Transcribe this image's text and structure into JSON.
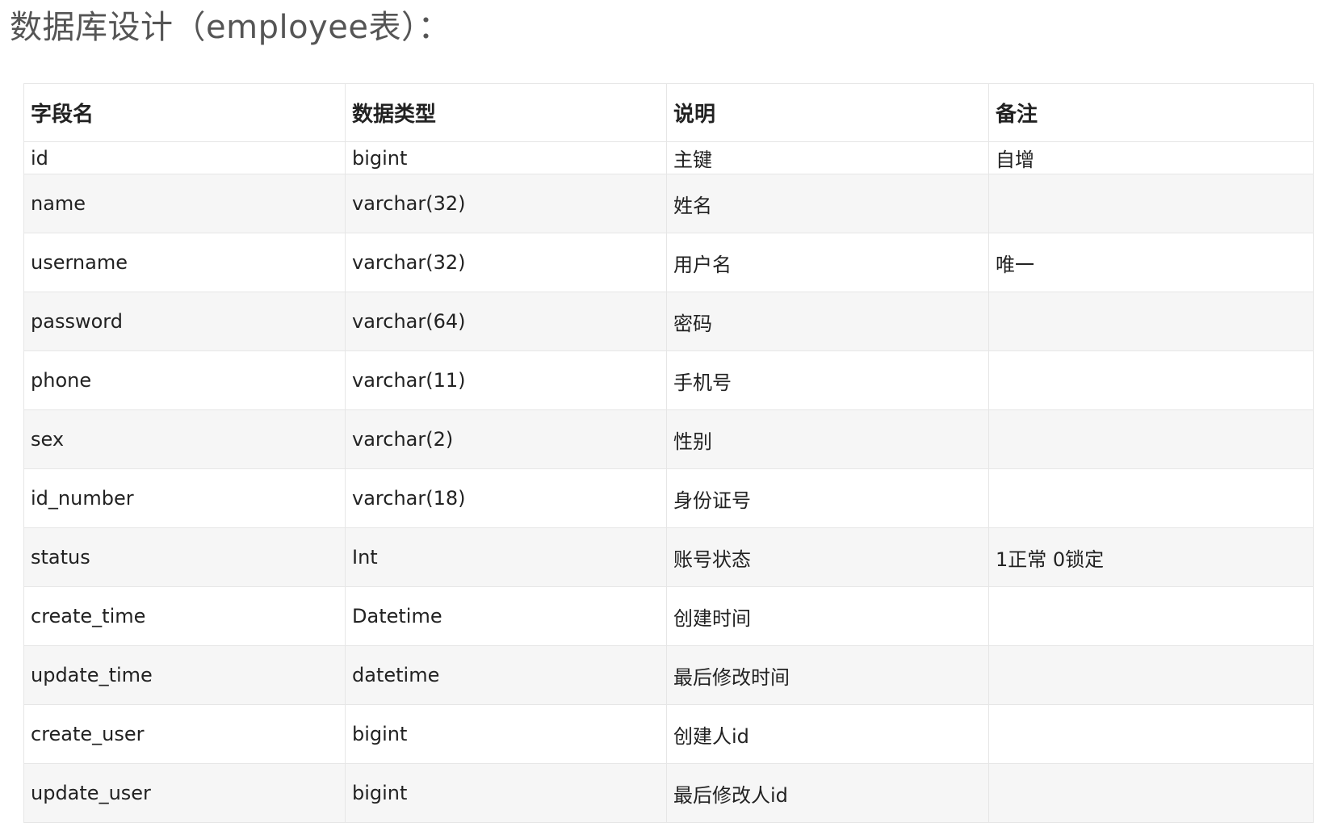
{
  "title": "数据库设计（employee表）：",
  "table": {
    "headers": [
      "字段名",
      "数据类型",
      "说明",
      "备注"
    ],
    "rows": [
      [
        "id",
        "bigint",
        "主键",
        "自增"
      ],
      [
        "name",
        "varchar(32)",
        "姓名",
        ""
      ],
      [
        "username",
        "varchar(32)",
        "用户名",
        "唯一"
      ],
      [
        "password",
        "varchar(64)",
        "密码",
        ""
      ],
      [
        "phone",
        "varchar(11)",
        "手机号",
        ""
      ],
      [
        "sex",
        "varchar(2)",
        "性别",
        ""
      ],
      [
        "id_number",
        "varchar(18)",
        "身份证号",
        ""
      ],
      [
        "status",
        "Int",
        "账号状态",
        "1正常 0锁定"
      ],
      [
        "create_time",
        "Datetime",
        "创建时间",
        ""
      ],
      [
        "update_time",
        "datetime",
        "最后修改时间",
        ""
      ],
      [
        "create_user",
        "bigint",
        "创建人id",
        ""
      ],
      [
        "update_user",
        "bigint",
        "最后修改人id",
        ""
      ]
    ]
  }
}
